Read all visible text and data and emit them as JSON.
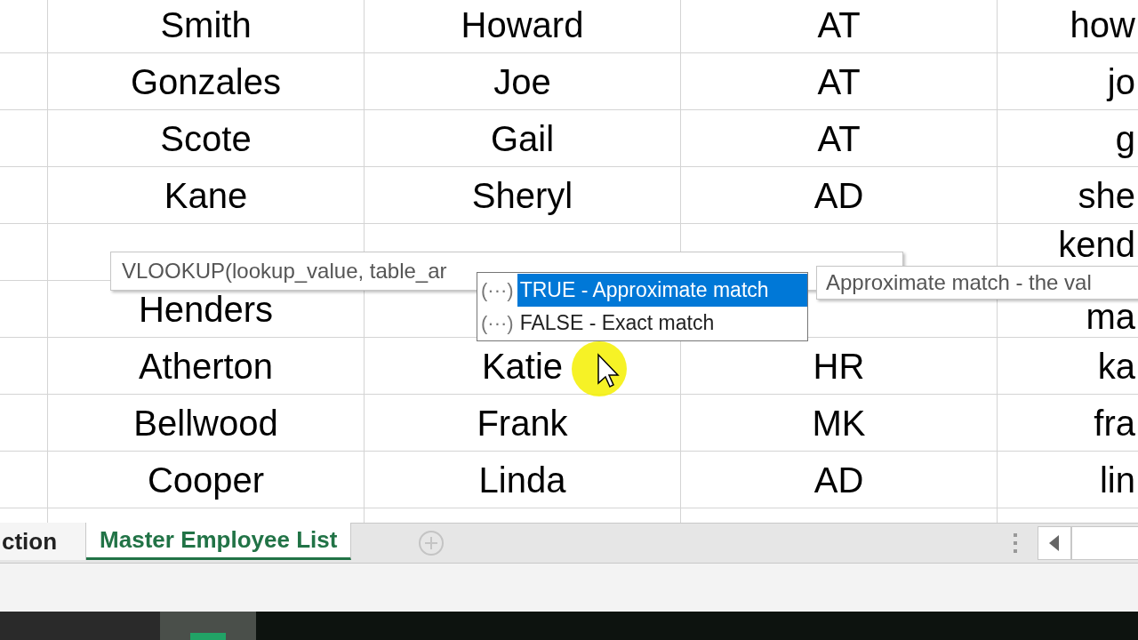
{
  "sheet": {
    "rows": [
      {
        "cells": [
          "Smith",
          "Howard",
          "AT",
          "how"
        ]
      },
      {
        "cells": [
          "Gonzales",
          "Joe",
          "AT",
          "jo"
        ]
      },
      {
        "cells": [
          "Scote",
          "Gail",
          "AT",
          "g"
        ]
      },
      {
        "cells": [
          "Kane",
          "Sheryl",
          "AD",
          "she"
        ]
      },
      {
        "cells": [
          "",
          "",
          "",
          "kend"
        ]
      },
      {
        "cells": [
          "Henders",
          "",
          "",
          "ma"
        ]
      },
      {
        "cells": [
          "Atherton",
          "Katie",
          "HR",
          "ka"
        ]
      },
      {
        "cells": [
          "Bellwood",
          "Frank",
          "MK",
          "fra"
        ]
      },
      {
        "cells": [
          "Cooper",
          "Linda",
          "AD",
          "lin"
        ]
      }
    ]
  },
  "formula_tooltip": {
    "text": "VLOOKUP(lookup_value, table_ar"
  },
  "autocomplete": {
    "items": [
      {
        "icon": "(···)",
        "label": "TRUE - Approximate match",
        "selected": true
      },
      {
        "icon": "(···)",
        "label": "FALSE - Exact match",
        "selected": false
      }
    ]
  },
  "description_tooltip": {
    "text": "Approximate match - the val"
  },
  "sheet_tabs": [
    {
      "label": "ction",
      "selected": false
    },
    {
      "label": "Master Employee List",
      "selected": true
    }
  ]
}
